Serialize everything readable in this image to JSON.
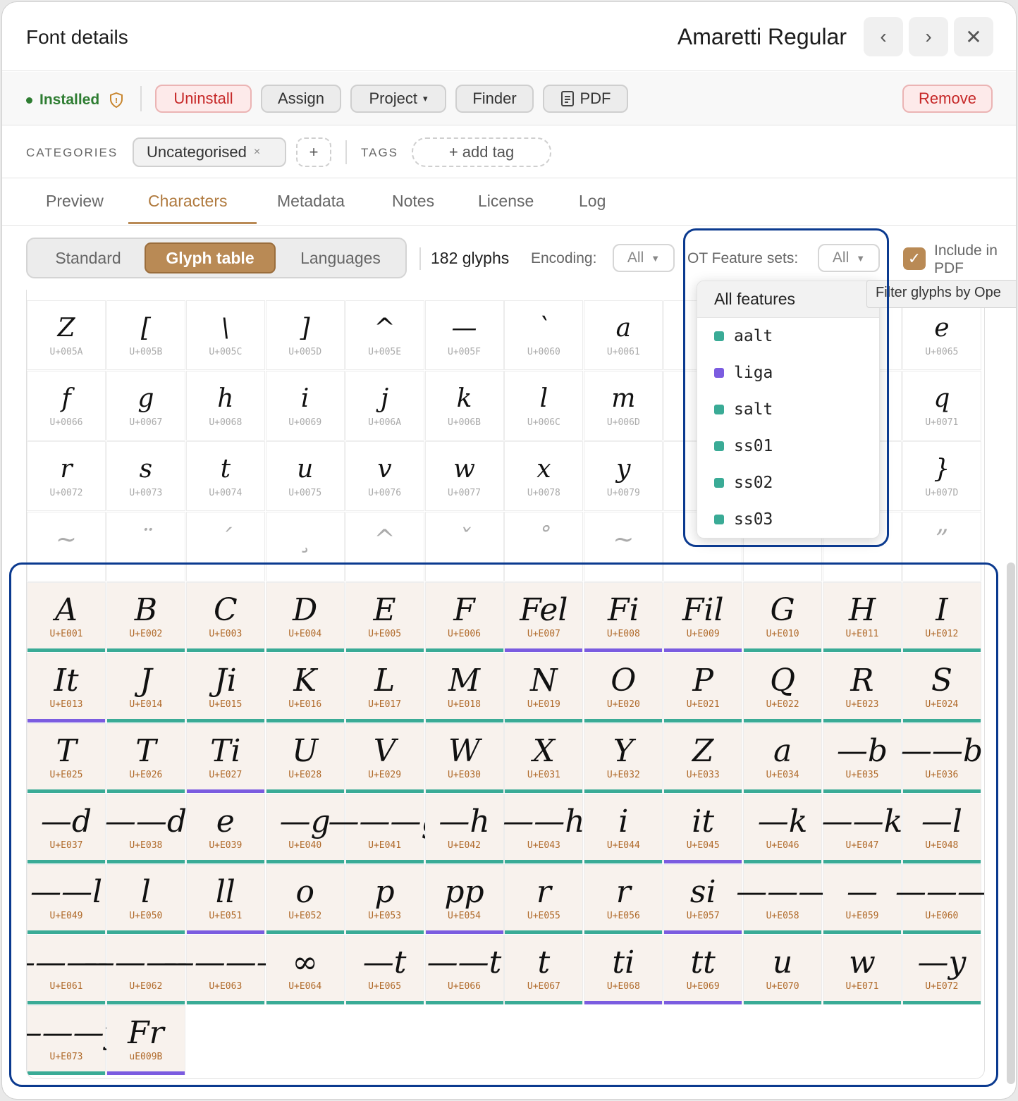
{
  "header": {
    "title": "Font details",
    "font_name": "Amaretti Regular",
    "prev": "‹",
    "next": "›",
    "close": "✕"
  },
  "actions": {
    "status": "Installed",
    "uninstall": "Uninstall",
    "assign": "Assign",
    "project": "Project",
    "project_caret": "▾",
    "finder": "Finder",
    "pdf": "PDF",
    "remove": "Remove"
  },
  "meta_row": {
    "categories_label": "CATEGORIES",
    "category_chip": "Uncategorised",
    "chip_remove": "×",
    "add_category": "+",
    "tags_label": "TAGS",
    "add_tag": "+ add tag"
  },
  "tabs": [
    "Preview",
    "Characters",
    "Metadata",
    "Notes",
    "License",
    "Log"
  ],
  "active_tab": "Characters",
  "toolbar": {
    "views": [
      "Standard",
      "Glyph table",
      "Languages"
    ],
    "active_view": "Glyph table",
    "glyph_count": "182 glyphs",
    "encoding_label": "Encoding:",
    "encoding_value": "All",
    "ot_label": "OT Feature sets:",
    "ot_value": "All",
    "caret": "▼",
    "include_pdf": "Include in PDF",
    "include_pdf_checked": true
  },
  "tooltip": "Filter glyphs by Ope",
  "ot_dropdown": {
    "header": "All features",
    "items": [
      {
        "label": "aalt",
        "color": "#3aab96"
      },
      {
        "label": "liga",
        "color": "#7b5ce0"
      },
      {
        "label": "salt",
        "color": "#3aab96"
      },
      {
        "label": "ss01",
        "color": "#3aab96"
      },
      {
        "label": "ss02",
        "color": "#3aab96"
      },
      {
        "label": "ss03",
        "color": "#3aab96"
      }
    ]
  },
  "feature_colors": {
    "aalt": "#3aab96",
    "liga": "#7b5ce0"
  },
  "standard_glyphs": [
    {
      "g": "Z",
      "cp": "U+005A"
    },
    {
      "g": "[",
      "cp": "U+005B"
    },
    {
      "g": "\\",
      "cp": "U+005C"
    },
    {
      "g": "]",
      "cp": "U+005D"
    },
    {
      "g": "^",
      "cp": "U+005E"
    },
    {
      "g": "—",
      "cp": "U+005F"
    },
    {
      "g": "`",
      "cp": "U+0060"
    },
    {
      "g": "a",
      "cp": "U+0061"
    },
    {
      "g": "",
      "cp": ""
    },
    {
      "g": "",
      "cp": ""
    },
    {
      "g": "",
      "cp": ""
    },
    {
      "g": "e",
      "cp": "U+0065"
    },
    {
      "g": "f",
      "cp": "U+0066"
    },
    {
      "g": "g",
      "cp": "U+0067"
    },
    {
      "g": "h",
      "cp": "U+0068"
    },
    {
      "g": "i",
      "cp": "U+0069"
    },
    {
      "g": "j",
      "cp": "U+006A"
    },
    {
      "g": "k",
      "cp": "U+006B"
    },
    {
      "g": "l",
      "cp": "U+006C"
    },
    {
      "g": "m",
      "cp": "U+006D"
    },
    {
      "g": "",
      "cp": ""
    },
    {
      "g": "",
      "cp": ""
    },
    {
      "g": "",
      "cp": ""
    },
    {
      "g": "q",
      "cp": "U+0071"
    },
    {
      "g": "r",
      "cp": "U+0072"
    },
    {
      "g": "s",
      "cp": "U+0073"
    },
    {
      "g": "t",
      "cp": "U+0074"
    },
    {
      "g": "u",
      "cp": "U+0075"
    },
    {
      "g": "v",
      "cp": "U+0076"
    },
    {
      "g": "w",
      "cp": "U+0077"
    },
    {
      "g": "x",
      "cp": "U+0078"
    },
    {
      "g": "y",
      "cp": "U+0079"
    },
    {
      "g": "",
      "cp": ""
    },
    {
      "g": "",
      "cp": ""
    },
    {
      "g": "",
      "cp": ""
    },
    {
      "g": "}",
      "cp": "U+007D"
    },
    {
      "g": "~",
      "cp": "",
      "dim": true
    },
    {
      "g": "¨",
      "cp": "",
      "dim": true
    },
    {
      "g": "ˊ",
      "cp": "",
      "dim": true
    },
    {
      "g": "¸",
      "cp": "",
      "dim": true
    },
    {
      "g": "^",
      "cp": "",
      "dim": true
    },
    {
      "g": "ˇ",
      "cp": "",
      "dim": true
    },
    {
      "g": "˚",
      "cp": "",
      "dim": true
    },
    {
      "g": "~",
      "cp": "",
      "dim": true
    },
    {
      "g": "",
      "cp": ""
    },
    {
      "g": "",
      "cp": ""
    },
    {
      "g": "",
      "cp": ""
    },
    {
      "g": "”",
      "cp": "",
      "dim": true
    }
  ],
  "pua_glyphs": [
    {
      "g": "A",
      "cp": "U+E001",
      "f": "aalt"
    },
    {
      "g": "B",
      "cp": "U+E002",
      "f": "aalt"
    },
    {
      "g": "C",
      "cp": "U+E003",
      "f": "aalt"
    },
    {
      "g": "D",
      "cp": "U+E004",
      "f": "aalt"
    },
    {
      "g": "E",
      "cp": "U+E005",
      "f": "aalt"
    },
    {
      "g": "F",
      "cp": "U+E006",
      "f": "aalt"
    },
    {
      "g": "Fel",
      "cp": "U+E007",
      "f": "liga"
    },
    {
      "g": "Fi",
      "cp": "U+E008",
      "f": "liga"
    },
    {
      "g": "Fil",
      "cp": "U+E009",
      "f": "liga"
    },
    {
      "g": "G",
      "cp": "U+E010",
      "f": "aalt"
    },
    {
      "g": "H",
      "cp": "U+E011",
      "f": "aalt"
    },
    {
      "g": "I",
      "cp": "U+E012",
      "f": "aalt"
    },
    {
      "g": "It",
      "cp": "U+E013",
      "f": "liga"
    },
    {
      "g": "J",
      "cp": "U+E014",
      "f": "aalt"
    },
    {
      "g": "Ji",
      "cp": "U+E015",
      "f": "aalt"
    },
    {
      "g": "K",
      "cp": "U+E016",
      "f": "aalt"
    },
    {
      "g": "L",
      "cp": "U+E017",
      "f": "aalt"
    },
    {
      "g": "M",
      "cp": "U+E018",
      "f": "aalt"
    },
    {
      "g": "N",
      "cp": "U+E019",
      "f": "aalt"
    },
    {
      "g": "O",
      "cp": "U+E020",
      "f": "aalt"
    },
    {
      "g": "P",
      "cp": "U+E021",
      "f": "aalt"
    },
    {
      "g": "Q",
      "cp": "U+E022",
      "f": "aalt"
    },
    {
      "g": "R",
      "cp": "U+E023",
      "f": "aalt"
    },
    {
      "g": "S",
      "cp": "U+E024",
      "f": "aalt"
    },
    {
      "g": "T",
      "cp": "U+E025",
      "f": "aalt"
    },
    {
      "g": "T",
      "cp": "U+E026",
      "f": "aalt"
    },
    {
      "g": "Ti",
      "cp": "U+E027",
      "f": "liga"
    },
    {
      "g": "U",
      "cp": "U+E028",
      "f": "aalt"
    },
    {
      "g": "V",
      "cp": "U+E029",
      "f": "aalt"
    },
    {
      "g": "W",
      "cp": "U+E030",
      "f": "aalt"
    },
    {
      "g": "X",
      "cp": "U+E031",
      "f": "aalt"
    },
    {
      "g": "Y",
      "cp": "U+E032",
      "f": "aalt"
    },
    {
      "g": "Z",
      "cp": "U+E033",
      "f": "aalt"
    },
    {
      "g": "a",
      "cp": "U+E034",
      "f": "aalt"
    },
    {
      "g": "—b",
      "cp": "U+E035",
      "f": "aalt"
    },
    {
      "g": "——b",
      "cp": "U+E036",
      "f": "aalt"
    },
    {
      "g": "—d",
      "cp": "U+E037",
      "f": "aalt"
    },
    {
      "g": "——d",
      "cp": "U+E038",
      "f": "aalt"
    },
    {
      "g": "e",
      "cp": "U+E039",
      "f": "aalt"
    },
    {
      "g": "—g",
      "cp": "U+E040",
      "f": "aalt"
    },
    {
      "g": "———g",
      "cp": "U+E041",
      "f": "aalt"
    },
    {
      "g": "—h",
      "cp": "U+E042",
      "f": "aalt"
    },
    {
      "g": "——h",
      "cp": "U+E043",
      "f": "aalt"
    },
    {
      "g": "i",
      "cp": "U+E044",
      "f": "aalt"
    },
    {
      "g": "it",
      "cp": "U+E045",
      "f": "liga"
    },
    {
      "g": "—k",
      "cp": "U+E046",
      "f": "aalt"
    },
    {
      "g": "——k",
      "cp": "U+E047",
      "f": "aalt"
    },
    {
      "g": "—l",
      "cp": "U+E048",
      "f": "aalt"
    },
    {
      "g": "——l",
      "cp": "U+E049",
      "f": "aalt"
    },
    {
      "g": "l",
      "cp": "U+E050",
      "f": "aalt"
    },
    {
      "g": "ll",
      "cp": "U+E051",
      "f": "liga"
    },
    {
      "g": "o",
      "cp": "U+E052",
      "f": "aalt"
    },
    {
      "g": "p",
      "cp": "U+E053",
      "f": "aalt"
    },
    {
      "g": "pp",
      "cp": "U+E054",
      "f": "liga"
    },
    {
      "g": "r",
      "cp": "U+E055",
      "f": "aalt"
    },
    {
      "g": "r",
      "cp": "U+E056",
      "f": "aalt"
    },
    {
      "g": "si",
      "cp": "U+E057",
      "f": "liga"
    },
    {
      "g": "———",
      "cp": "U+E058",
      "f": "aalt"
    },
    {
      "g": "—",
      "cp": "U+E059",
      "f": "aalt"
    },
    {
      "g": "———",
      "cp": "U+E060",
      "f": "aalt"
    },
    {
      "g": "————",
      "cp": "U+E061",
      "f": "aalt"
    },
    {
      "g": "————",
      "cp": "U+E062",
      "f": "aalt"
    },
    {
      "g": "————",
      "cp": "U+E063",
      "f": "aalt"
    },
    {
      "g": "∞",
      "cp": "U+E064",
      "f": "aalt"
    },
    {
      "g": "—t",
      "cp": "U+E065",
      "f": "aalt"
    },
    {
      "g": "——t",
      "cp": "U+E066",
      "f": "aalt"
    },
    {
      "g": "t",
      "cp": "U+E067",
      "f": "aalt"
    },
    {
      "g": "ti",
      "cp": "U+E068",
      "f": "liga"
    },
    {
      "g": "tt",
      "cp": "U+E069",
      "f": "liga"
    },
    {
      "g": "u",
      "cp": "U+E070",
      "f": "aalt"
    },
    {
      "g": "w",
      "cp": "U+E071",
      "f": "aalt"
    },
    {
      "g": "—y",
      "cp": "U+E072",
      "f": "aalt"
    },
    {
      "g": "———y",
      "cp": "U+E073",
      "f": "aalt"
    },
    {
      "g": "Fr",
      "cp": "uE009B",
      "f": "liga"
    }
  ]
}
